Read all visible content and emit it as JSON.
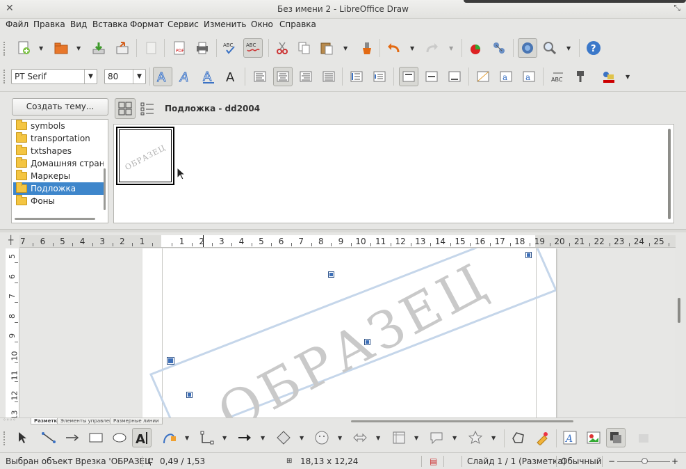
{
  "window": {
    "title": "Без имени 2 - LibreOffice Draw"
  },
  "menu": [
    "Файл",
    "Правка",
    "Вид",
    "Вставка",
    "Формат",
    "Сервис",
    "Изменить",
    "Окно",
    "Справка"
  ],
  "format_bar": {
    "font_name": "PT Serif",
    "font_size": "80"
  },
  "gallery": {
    "create_theme_button": "Создать тему...",
    "header_title": "Подложка - dd2004",
    "themes": [
      "symbols",
      "transportation",
      "txtshapes",
      "Домашняя страниц",
      "Маркеры",
      "Подложка",
      "Фоны"
    ],
    "selected_theme": "Подложка",
    "thumbnail_text": "ОБРАЗЕЦ"
  },
  "ruler": {
    "horizontal_left": [
      "7",
      "6",
      "5",
      "4",
      "3",
      "2",
      "1"
    ],
    "horizontal_right": [
      "1",
      "2",
      "3",
      "4",
      "5",
      "6",
      "7",
      "8",
      "9",
      "10",
      "11",
      "12",
      "13",
      "14",
      "15",
      "16",
      "17",
      "18",
      "19",
      "20",
      "21",
      "22",
      "23",
      "24",
      "25",
      "2"
    ],
    "vertical": [
      "5",
      "6",
      "7",
      "8",
      "9",
      "10",
      "11",
      "12",
      "13"
    ]
  },
  "canvas": {
    "watermark_text": "ОБРАЗЕЦ"
  },
  "sheet_tabs": [
    "Разметка",
    "Элементы управления",
    "Размерные линии"
  ],
  "status": {
    "selection": "Выбран объект Врезка 'ОБРАЗЕЦ'",
    "position": "0,49 / 1,53",
    "size": "18,13 x 12,24",
    "slide": "Слайд 1 / 1 (Разметка)",
    "style": "Обычный"
  },
  "colors": {
    "selection": "#3e86cb",
    "handle": "#3d6fb8",
    "frame": "#c5d6ea",
    "watermark": "#c9c9c9"
  }
}
